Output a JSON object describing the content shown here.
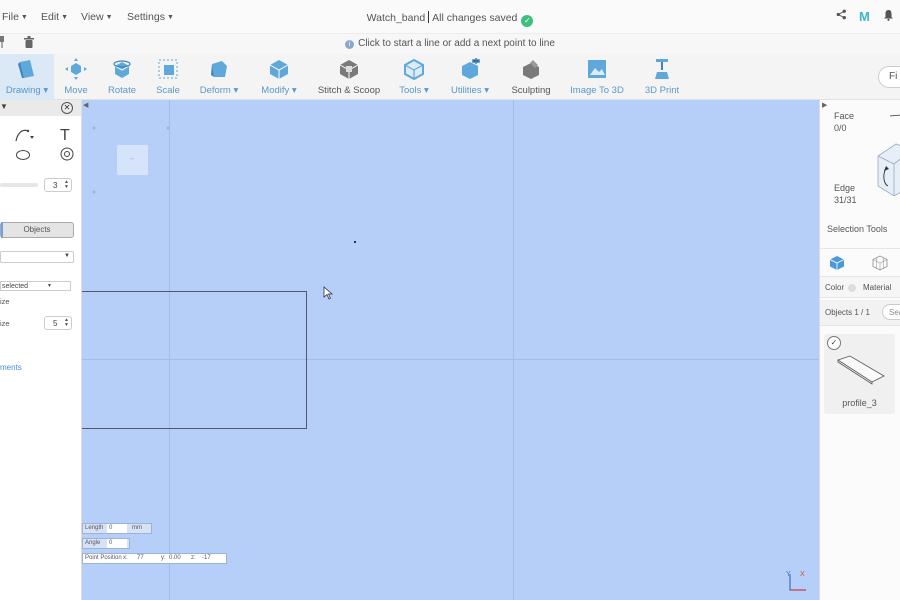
{
  "menubar": {
    "items": [
      {
        "label": "File"
      },
      {
        "label": "Edit"
      },
      {
        "label": "View"
      },
      {
        "label": "Settings"
      }
    ],
    "doc_title": "Watch_band",
    "save_status": "All changes saved",
    "brand_letter": "M"
  },
  "hint": {
    "text": "Click to start a line or add a next point to line"
  },
  "toolbar": {
    "tools": [
      {
        "label": "Drawing",
        "has_menu": true
      },
      {
        "label": "Move"
      },
      {
        "label": "Rotate"
      },
      {
        "label": "Scale"
      },
      {
        "label": "Deform",
        "has_menu": true
      },
      {
        "label": "Modify",
        "has_menu": true
      },
      {
        "label": "Stitch & Scoop"
      },
      {
        "label": "Tools",
        "has_menu": true
      },
      {
        "label": "Utilities",
        "has_menu": true
      },
      {
        "label": "Sculpting"
      },
      {
        "label": "Image To 3D"
      },
      {
        "label": "3D Print"
      }
    ],
    "find_label": "Fi"
  },
  "left_panel": {
    "text_tool_glyph": "T",
    "stroke_value": "3",
    "objects_button": "Objects",
    "selected_text": "selected",
    "size_label_1": "ize",
    "size_label_2": "ize",
    "size_value": "5",
    "link_text": "ments"
  },
  "canvas": {
    "length_label": "Length",
    "length_value": "0",
    "length_unit": "mm",
    "angle_label": "Angle",
    "angle_value": "0",
    "point_position_label": "Point Position",
    "x_label": "x:",
    "x_value": "77",
    "y_label": "y:",
    "y_value": "0.00",
    "z_label": "z:",
    "z_value": "-17",
    "axis_y": "Y",
    "axis_x": "X"
  },
  "right_panel": {
    "face_label": "Face",
    "face_value": "0/0",
    "edge_label": "Edge",
    "edge_value": "31/31",
    "selection_tools": "Selection Tools",
    "color_label": "Color",
    "material_label": "Material",
    "objects_count": "Objects 1 / 1",
    "search_placeholder": "Sea",
    "object_name": "profile_3"
  },
  "colors": {
    "canvas_bg": "#b6cff8",
    "accent": "#5a98c8",
    "saved_green": "#3fbf7f"
  }
}
